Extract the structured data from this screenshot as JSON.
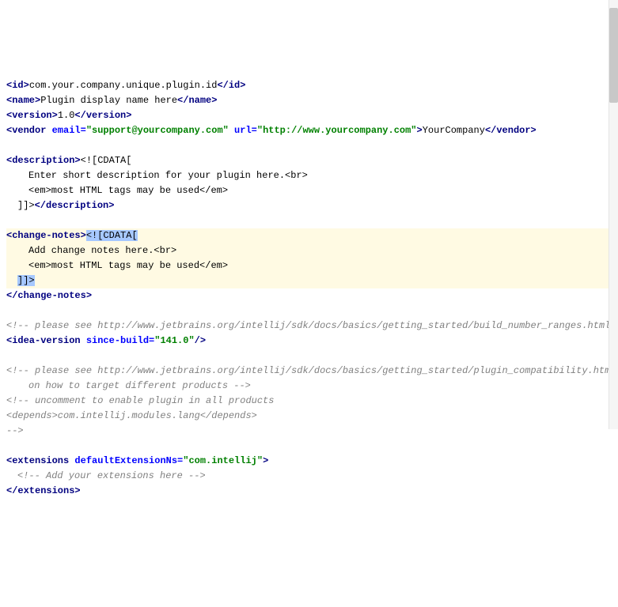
{
  "l1": {
    "opentag": "<id>",
    "text": "com.your.company.unique.plugin.id",
    "closetag": "</id>"
  },
  "l2": {
    "opentag": "<name>",
    "text": "Plugin display name here",
    "closetag": "</name>"
  },
  "l3": {
    "open": "<version>",
    "text": "1.0",
    "close": "</version>"
  },
  "l4": {
    "open": "<vendor ",
    "a1": "email=",
    "v1": "\"support@yourcompany.com\"",
    "a2": " url=",
    "v2": "\"http://www.yourcompany.com\"",
    "close": ">",
    "text": "YourCompany",
    "endtag": "</vendor>"
  },
  "l6": {
    "open": "<description>",
    "cdata": "<![CDATA["
  },
  "l7": "Enter short description for your plugin here.<br>",
  "l8": "<em>most HTML tags may be used</em>",
  "l9": {
    "cdata": "]]>",
    "close": "</description>"
  },
  "l11": {
    "open": "<change-notes>",
    "cdata": "<![CDATA["
  },
  "l12": "Add change notes here.<br>",
  "l13": "<em>most HTML tags may be used</em>",
  "l14": "]]>",
  "l15": "</change-notes>",
  "l17": "<!-- please see http://www.jetbrains.org/intellij/sdk/docs/basics/getting_started/build_number_ranges.html for description -->",
  "l18": {
    "open": "<idea-version ",
    "a1": "since-build=",
    "v1": "\"141.0\"",
    "close": "/>"
  },
  "l20": "<!-- please see http://www.jetbrains.org/intellij/sdk/docs/basics/getting_started/plugin_compatibility.html",
  "l21": "on how to target different products -->",
  "l22": "<!-- uncomment to enable plugin in all products",
  "l23": "<depends>com.intellij.modules.lang</depends>",
  "l24": "-->",
  "l26": {
    "open": "<extensions ",
    "a1": "defaultExtensionNs=",
    "v1": "\"com.intellij\"",
    "close": ">"
  },
  "l27": "<!-- Add your extensions here -->",
  "l28": "</extensions>"
}
